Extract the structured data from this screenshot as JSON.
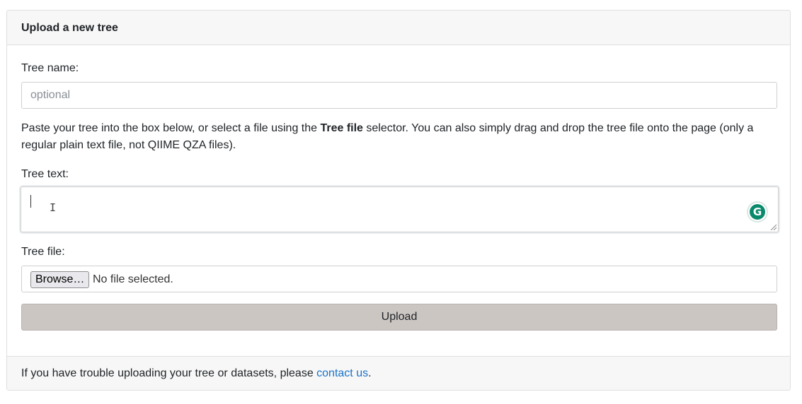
{
  "card": {
    "title": "Upload a new tree"
  },
  "form": {
    "tree_name_label": "Tree name:",
    "tree_name_placeholder": "optional",
    "tree_name_value": "",
    "help_prefix": "Paste your tree into the box below, or select a file using the ",
    "help_bold": "Tree file",
    "help_suffix": " selector. You can also simply drag and drop the tree file onto the page (only a regular plain text file, not QIIME QZA files).",
    "tree_text_label": "Tree text:",
    "tree_text_value": "",
    "tree_file_label": "Tree file:",
    "browse_label": "Browse…",
    "file_status": "No file selected.",
    "upload_label": "Upload"
  },
  "footer": {
    "text_before": "If you have trouble uploading your tree or datasets, please ",
    "link_text": "contact us",
    "text_after": "."
  },
  "icons": {
    "grammarly": "grammarly-icon",
    "text_cursor": "i-beam-cursor-icon",
    "resize": "resize-grip-icon"
  },
  "colors": {
    "link": "#1a73c8",
    "upload_button_bg": "#ccc6c3",
    "header_bg": "#f7f7f7",
    "grammarly": "#0a8a6c"
  }
}
